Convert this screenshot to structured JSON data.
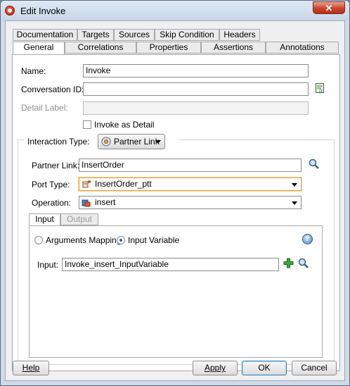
{
  "window": {
    "title": "Edit Invoke",
    "close_glyph": "✕"
  },
  "tabs_row1": [
    "Documentation",
    "Targets",
    "Sources",
    "Skip Condition",
    "Headers"
  ],
  "tabs_row2": [
    "General",
    "Correlations",
    "Properties",
    "Assertions",
    "Annotations"
  ],
  "active_tab": "General",
  "general": {
    "name_label": "Name:",
    "name_value": "Invoke",
    "conversation_label": "Conversation ID:",
    "conversation_value": "",
    "detail_label": "Detail Label:",
    "detail_value": "",
    "invoke_as_detail": "Invoke as Detail",
    "invoke_as_detail_checked": false,
    "interaction_type_label": "Interaction Type:",
    "interaction_type_value": "Partner Link",
    "partner_link_label": "Partner Link:",
    "partner_link_value": "InsertOrder",
    "port_type_label": "Port Type:",
    "port_type_value": "InsertOrder_ptt",
    "operation_label": "Operation:",
    "operation_value": "insert"
  },
  "io_tabs": [
    "Input",
    "Output"
  ],
  "active_io_tab": "Input",
  "io": {
    "arguments_mapping": "Arguments Mapping",
    "input_variable": "Input Variable",
    "selected_option": "Input Variable",
    "input_label": "Input:",
    "input_value": "Invoke_insert_InputVariable",
    "help_glyph": "?"
  },
  "buttons": {
    "help": "Help",
    "apply": "Apply",
    "ok": "OK",
    "cancel": "Cancel"
  },
  "colors": {
    "accent": "#e3a23a",
    "default_button_border": "#3c7fb1",
    "add_icon": "#2e9a2e"
  }
}
